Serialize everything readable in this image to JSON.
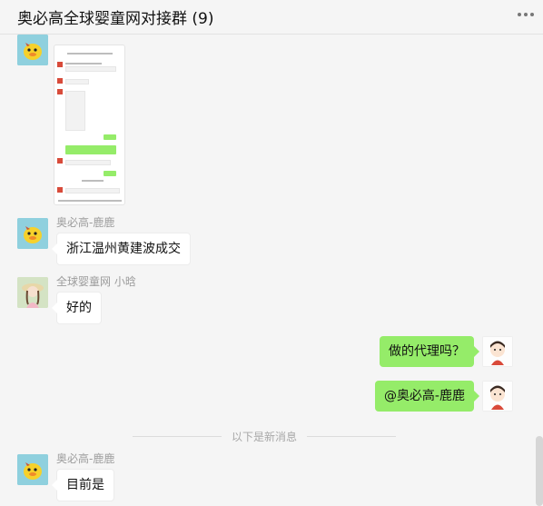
{
  "header": {
    "title": "奥必高全球婴童网对接群 (9)"
  },
  "messages": [
    {
      "type": "image",
      "sender": "奥必高-鹿鹿",
      "side": "left",
      "avatar": "duck-avatar"
    },
    {
      "type": "text",
      "sender": "奥必高-鹿鹿",
      "text": "浙江温州黄建波成交",
      "side": "left",
      "avatar": "duck-avatar"
    },
    {
      "type": "text",
      "sender": "全球婴童网  小晗",
      "text": "好的",
      "side": "left",
      "avatar": "girl-avatar"
    },
    {
      "type": "text",
      "sender": "",
      "text": "做的代理吗？",
      "side": "right",
      "avatar": "cartoon-avatar"
    },
    {
      "type": "text",
      "sender": "",
      "text": "@奥必高-鹿鹿",
      "side": "right",
      "avatar": "cartoon-avatar"
    },
    {
      "type": "text",
      "sender": "奥必高-鹿鹿",
      "text": "目前是",
      "side": "left",
      "avatar": "duck-avatar"
    }
  ],
  "divider": {
    "text": "以下是新消息"
  },
  "colors": {
    "bubble_self": "#95ec69",
    "bubble_other": "#ffffff",
    "background": "#f5f5f5"
  }
}
